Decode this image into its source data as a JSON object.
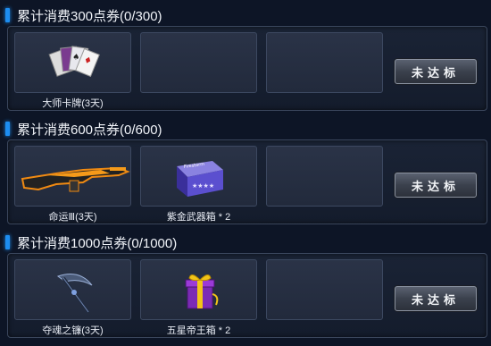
{
  "tiers": [
    {
      "title": "累计消费300点券(0/300)",
      "status_label": "未达标",
      "rewards": [
        {
          "label": "大师卡牌(3天)",
          "icon": "playing-cards-icon"
        }
      ]
    },
    {
      "title": "累计消费600点券(0/600)",
      "status_label": "未达标",
      "rewards": [
        {
          "label": "命运Ⅲ(3天)",
          "icon": "rifle-icon"
        },
        {
          "label": "紫金武器箱 * 2",
          "icon": "weapon-box-icon"
        }
      ]
    },
    {
      "title": "累计消费1000点券(0/1000)",
      "status_label": "未达标",
      "rewards": [
        {
          "label": "夺魂之镰(3天)",
          "icon": "scythe-icon"
        },
        {
          "label": "五星帝王箱 * 2",
          "icon": "gift-box-icon"
        }
      ]
    }
  ],
  "colors": {
    "accent": "#1d8df0",
    "panel_bg": "#1a2335",
    "slot_bg": "#2a3347",
    "button_bg": "#3b414d"
  }
}
